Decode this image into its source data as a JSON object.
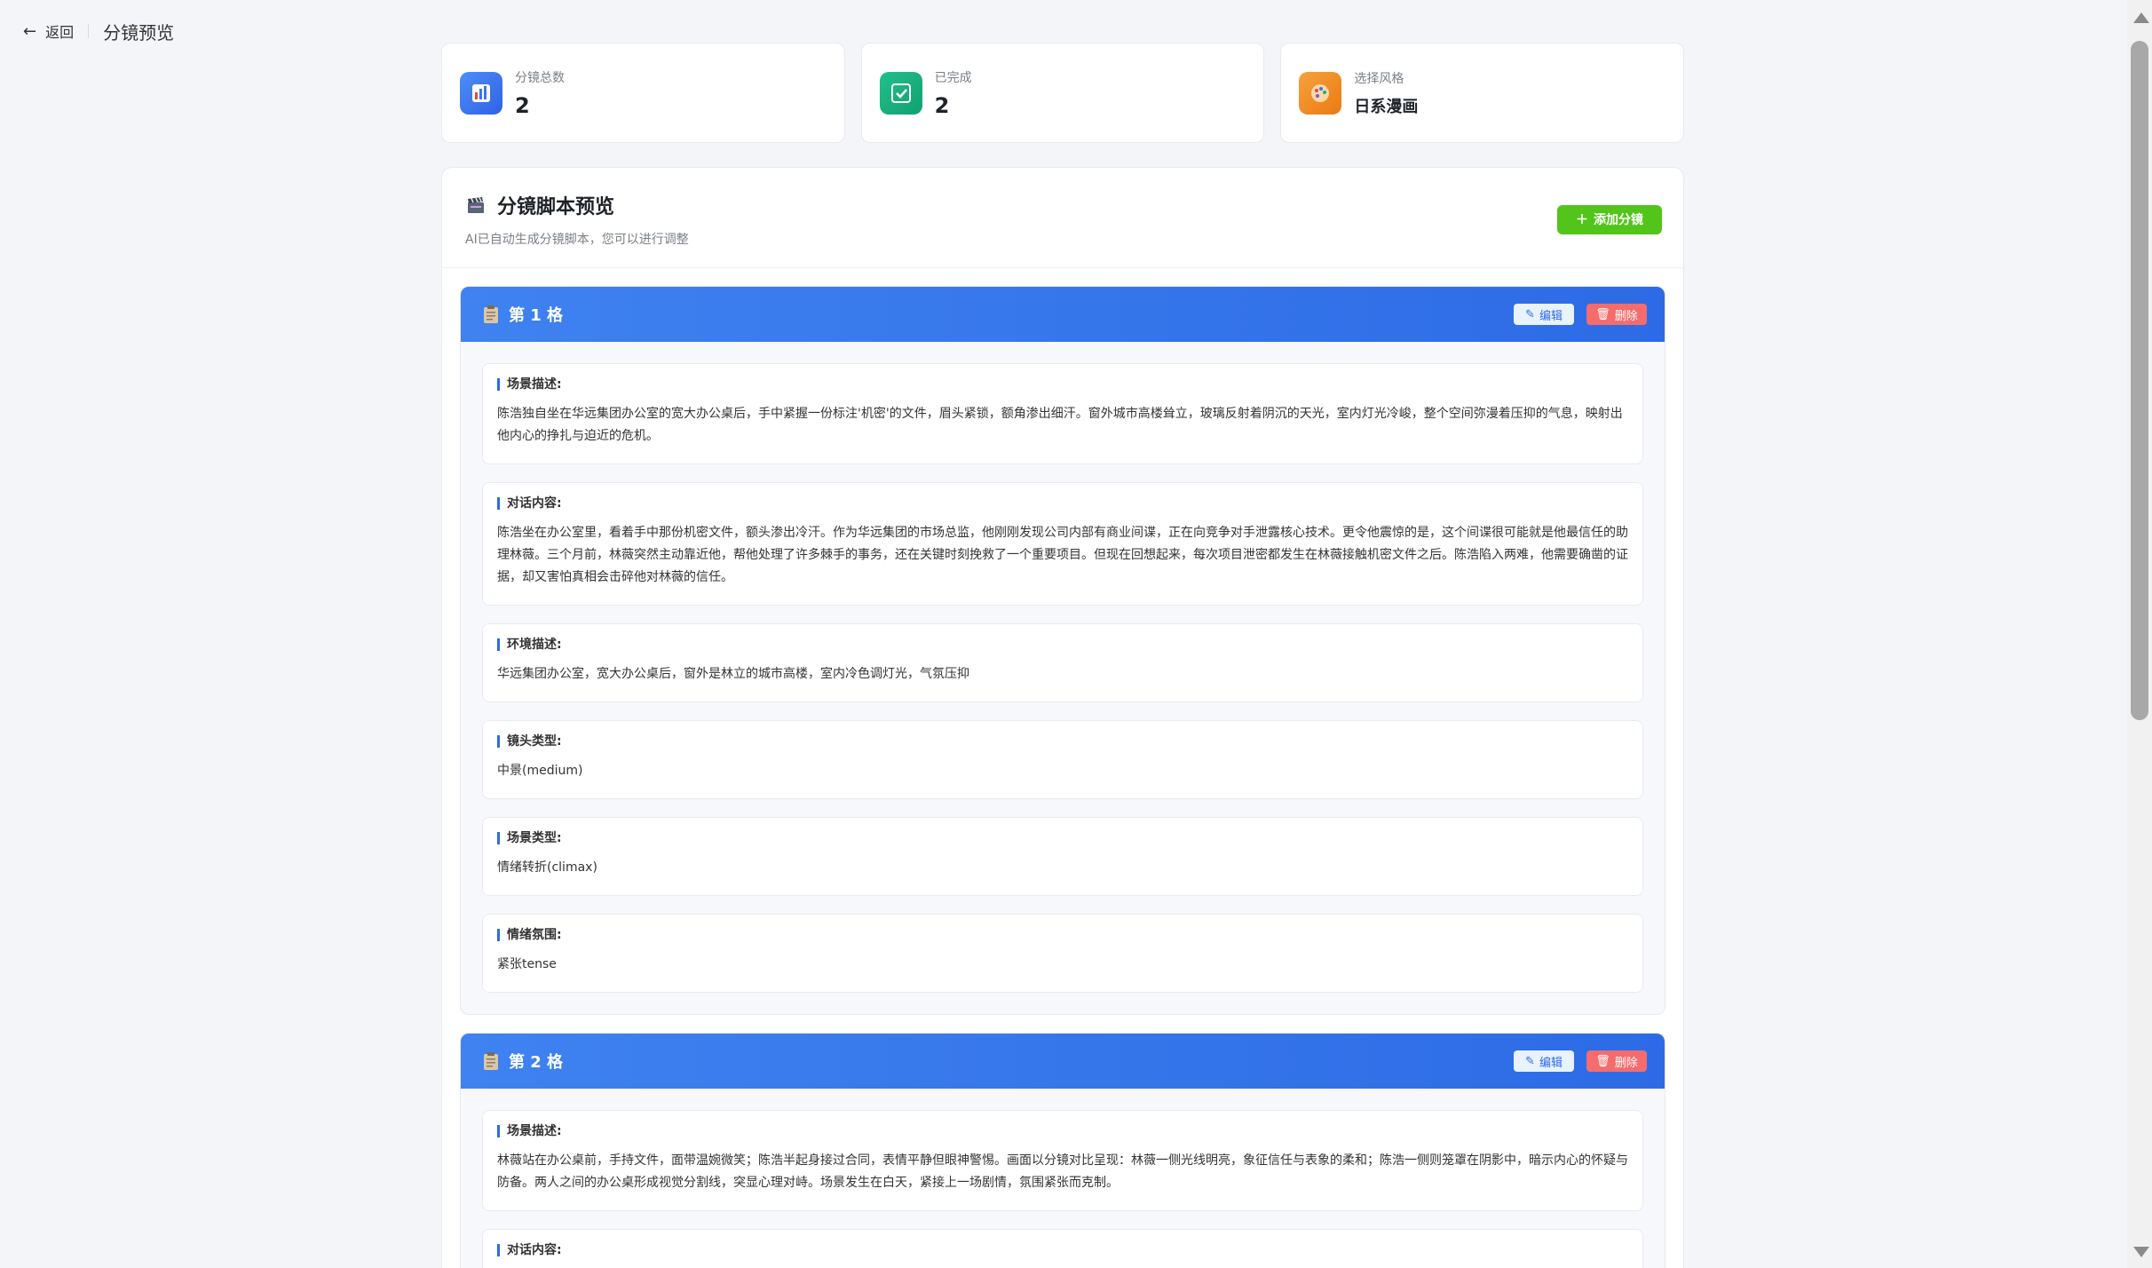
{
  "topbar": {
    "back_label": "返回",
    "title": "分镜预览"
  },
  "stats": [
    {
      "label": "分镜总数",
      "value": "2",
      "icon": "chart-icon",
      "color": "#3b74ef"
    },
    {
      "label": "已完成",
      "value": "2",
      "icon": "check-icon",
      "color": "#18b07d"
    },
    {
      "label": "选择风格",
      "value": "日系漫画",
      "icon": "palette-icon",
      "color": "#f08a20"
    }
  ],
  "card": {
    "title": "分镜脚本预览",
    "subtitle": "AI已自动生成分镜脚本，您可以进行调整",
    "add_button": "添加分镜"
  },
  "panels": [
    {
      "title": "第 1 格",
      "edit_label": "编辑",
      "delete_label": "删除",
      "fields": [
        {
          "label": "场景描述:",
          "text": "陈浩独自坐在华远集团办公室的宽大办公桌后，手中紧握一份标注'机密'的文件，眉头紧锁，额角渗出细汗。窗外城市高楼耸立，玻璃反射着阴沉的天光，室内灯光冷峻，整个空间弥漫着压抑的气息，映射出他内心的挣扎与迫近的危机。"
        },
        {
          "label": "对话内容:",
          "text": "陈浩坐在办公室里，看着手中那份机密文件，额头渗出冷汗。作为华远集团的市场总监，他刚刚发现公司内部有商业间谍，正在向竞争对手泄露核心技术。更令他震惊的是，这个间谍很可能就是他最信任的助理林薇。三个月前，林薇突然主动靠近他，帮他处理了许多棘手的事务，还在关键时刻挽救了一个重要项目。但现在回想起来，每次项目泄密都发生在林薇接触机密文件之后。陈浩陷入两难，他需要确凿的证据，却又害怕真相会击碎他对林薇的信任。"
        },
        {
          "label": "环境描述:",
          "text": "华远集团办公室，宽大办公桌后，窗外是林立的城市高楼，室内冷色调灯光，气氛压抑"
        },
        {
          "label": "镜头类型:",
          "text": "中景(medium)"
        },
        {
          "label": "场景类型:",
          "text": "情绪转折(climax)"
        },
        {
          "label": "情绪氛围:",
          "text": "紧张tense"
        }
      ]
    },
    {
      "title": "第 2 格",
      "edit_label": "编辑",
      "delete_label": "删除",
      "fields": [
        {
          "label": "场景描述:",
          "text": "林薇站在办公桌前，手持文件，面带温婉微笑；陈浩半起身接过合同，表情平静但眼神警惕。画面以分镜对比呈现：林薇一侧光线明亮，象征信任与表象的柔和；陈浩一侧则笼罩在阴影中，暗示内心的怀疑与防备。两人之间的办公桌形成视觉分割线，突显心理对峙。场景发生在白天，紧接上一场剧情，氛围紧张而克制。"
        },
        {
          "label": "对话内容:",
          "text": ""
        }
      ]
    }
  ]
}
